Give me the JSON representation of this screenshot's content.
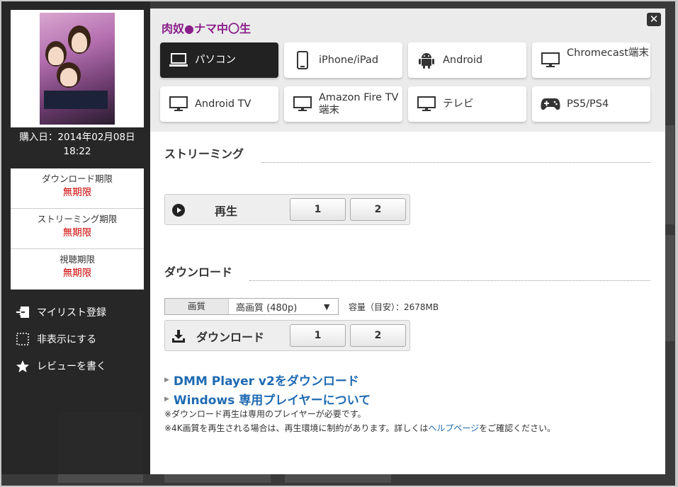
{
  "header": {
    "title": "肉奴●ナマ中〇生",
    "close_label": "✕"
  },
  "cover": {
    "alt": "肉奴隷ナマ中〇生"
  },
  "purchase": {
    "line1": "購入日：2014年02月08日",
    "line2": "18:22"
  },
  "limits": [
    {
      "label": "ダウンロード期限",
      "value": "無期限"
    },
    {
      "label": "ストリーミング期限",
      "value": "無期限"
    },
    {
      "label": "視聴期限",
      "value": "無期限"
    }
  ],
  "sidebar_links": [
    {
      "label": "マイリスト登録",
      "icon": "mylist-add-icon"
    },
    {
      "label": "非表示にする",
      "icon": "hide-icon"
    },
    {
      "label": "レビューを書く",
      "icon": "star-icon"
    }
  ],
  "devices": [
    {
      "label": "パソコン",
      "icon": "laptop-icon",
      "active": true
    },
    {
      "label": "iPhone/iPad",
      "icon": "smartphone-icon",
      "active": false
    },
    {
      "label": "Android",
      "icon": "android-icon",
      "active": false
    },
    {
      "label": "Chromecast端末",
      "icon": "monitor-icon",
      "active": false
    },
    {
      "label": "Android TV",
      "icon": "monitor-icon",
      "active": false
    },
    {
      "label": "Amazon Fire TV端末",
      "icon": "monitor-icon",
      "active": false
    },
    {
      "label": "テレビ",
      "icon": "monitor-icon",
      "active": false
    },
    {
      "label": "PS5/PS4",
      "icon": "gamepad-icon",
      "active": false
    }
  ],
  "streaming": {
    "title": "ストリーミング",
    "play_label": "再生",
    "parts": [
      "1",
      "2"
    ]
  },
  "download": {
    "title": "ダウンロード",
    "quality_label": "画質",
    "quality_value": "高画質 (480p)",
    "capacity": "容量（目安）：2678MB",
    "button_label": "ダウンロード",
    "parts": [
      "1",
      "2"
    ]
  },
  "links": {
    "player": "DMM Player v2をダウンロード",
    "windows": "Windows 専用プレイヤーについて"
  },
  "notes": {
    "note1": "※ダウンロード再生は専用のプレイヤーが必要です。",
    "note2_pre": "※4K画質を再生される場合は、再生環境に制約があります。詳しくは",
    "note2_link": "ヘルプページ",
    "note2_post": "をご確認ください。"
  },
  "colors": {
    "title": "#8a1f8a",
    "limit_value": "#cc0000",
    "link": "#1f6ab2",
    "active_device": "#222222"
  }
}
